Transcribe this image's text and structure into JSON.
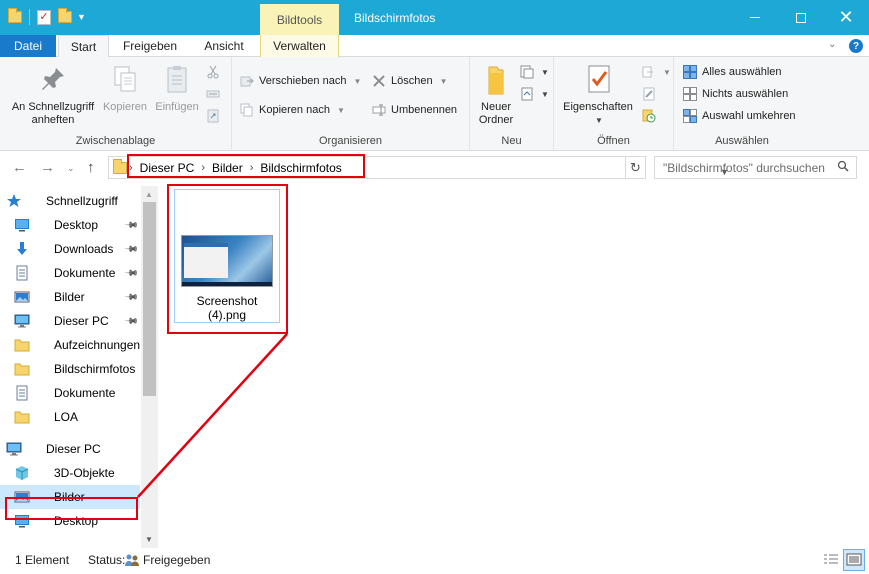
{
  "titlebar": {
    "context_tab_header": "Bildtools",
    "window_title": "Bildschirmfotos"
  },
  "ribbon_tabs": {
    "datei": "Datei",
    "start": "Start",
    "freigeben": "Freigeben",
    "ansicht": "Ansicht",
    "verwalten": "Verwalten"
  },
  "ribbon": {
    "zwischenablage": {
      "label": "Zwischenablage",
      "pin_quick_access": "An Schnellzugriff anheften",
      "copy": "Kopieren",
      "paste": "Einfügen"
    },
    "organisieren": {
      "label": "Organisieren",
      "move_to": "Verschieben nach",
      "copy_to": "Kopieren nach",
      "delete": "Löschen",
      "rename": "Umbenennen"
    },
    "neu": {
      "label": "Neu",
      "new_folder": "Neuer Ordner"
    },
    "oeffnen": {
      "label": "Öffnen",
      "properties": "Eigenschaften"
    },
    "auswaehlen": {
      "label": "Auswählen",
      "select_all": "Alles auswählen",
      "select_none": "Nichts auswählen",
      "invert_selection": "Auswahl umkehren"
    }
  },
  "address_bar": {
    "crumbs": [
      "Dieser PC",
      "Bilder",
      "Bildschirmfotos"
    ],
    "search_placeholder": "\"Bildschirmfotos\" durchsuchen"
  },
  "nav_pane": {
    "items": [
      {
        "label": "Schnellzugriff",
        "icon": "star-icon",
        "pinned": false
      },
      {
        "label": "Desktop",
        "icon": "desktop-icon",
        "pinned": true
      },
      {
        "label": "Downloads",
        "icon": "download-icon",
        "pinned": true
      },
      {
        "label": "Dokumente",
        "icon": "document-icon",
        "pinned": true
      },
      {
        "label": "Bilder",
        "icon": "pictures-icon",
        "pinned": true
      },
      {
        "label": "Dieser PC",
        "icon": "computer-icon",
        "pinned": true
      },
      {
        "label": "Aufzeichnungen",
        "icon": "folder-icon",
        "pinned": false
      },
      {
        "label": "Bildschirmfotos",
        "icon": "folder-icon",
        "pinned": false
      },
      {
        "label": "Dokumente",
        "icon": "document-icon",
        "pinned": false
      },
      {
        "label": "LOA",
        "icon": "folder-icon",
        "pinned": false
      },
      {
        "label": "Dieser PC",
        "icon": "computer-icon",
        "pinned": false
      },
      {
        "label": "3D-Objekte",
        "icon": "cube-icon",
        "pinned": false
      },
      {
        "label": "Bilder",
        "icon": "pictures-icon",
        "pinned": false
      },
      {
        "label": "Desktop",
        "icon": "desktop-icon",
        "pinned": false
      }
    ],
    "selected_label": "Bilder"
  },
  "content": {
    "files": [
      {
        "name_line1": "Screenshot",
        "name_line2": "(4).png",
        "type": "png"
      }
    ]
  },
  "statusbar": {
    "count": "1 Element",
    "status_label": "Status:",
    "status_value": "Freigegeben"
  },
  "colors": {
    "titlebar": "#1da8d5",
    "datei_tab": "#1979ca",
    "context_tab": "#f9f3b7",
    "highlight": "#e3000f",
    "selection": "#cce8ff"
  }
}
